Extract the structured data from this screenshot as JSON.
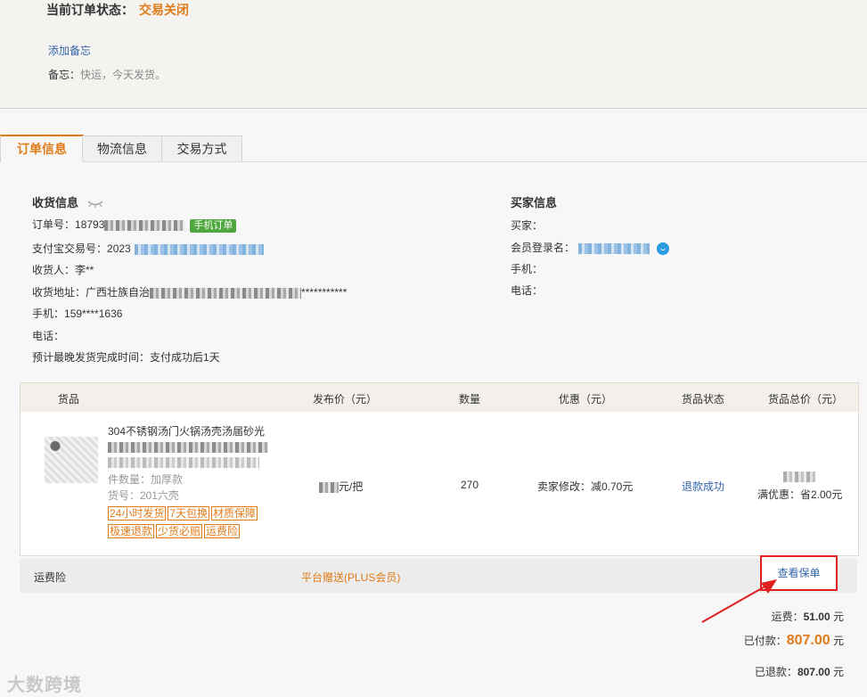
{
  "status": {
    "label": "当前订单状态：",
    "value": "交易关闭"
  },
  "remark": {
    "add_label": "添加备忘",
    "label": "备忘：",
    "value": "快运，今天发货。"
  },
  "tabs": [
    {
      "label": "订单信息"
    },
    {
      "label": "物流信息"
    },
    {
      "label": "交易方式"
    }
  ],
  "receiver": {
    "title": "收货信息",
    "order_no_label": "订单号：",
    "order_no_prefix": "18793",
    "mobile_order_tag": "手机订单",
    "alipay_label": "支付宝交易号：",
    "alipay_prefix": "2023",
    "name_label": "收货人：",
    "name": "李**",
    "address_label": "收货地址：",
    "address_prefix": "广西壮族自治",
    "address_suffix": "***********",
    "phone_label": "手机：",
    "phone": "159****1636",
    "tel_label": "电话：",
    "ship_time_label": "预计最晚发货完成时间：",
    "ship_time": "支付成功后1天"
  },
  "buyer": {
    "title": "买家信息",
    "buyer_label": "买家：",
    "member_label": "会员登录名：",
    "phone_label": "手机：",
    "tel_label": "电话："
  },
  "goods": {
    "headers": {
      "item": "货品",
      "price": "发布价（元）",
      "qty": "数量",
      "discount": "优惠（元）",
      "status": "货品状态",
      "total": "货品总价（元）"
    },
    "product": {
      "name_line1": "304不锈钢汤门火锅汤壳汤届砂光",
      "count_label": "件数量：加厚款",
      "sku_label": "货号：201六壳",
      "badges": [
        "24小时发货",
        "7天包换",
        "材质保障",
        "极速退款",
        "少货必赔",
        "运费险"
      ],
      "price_suffix": "元/把",
      "qty": "270",
      "discount": "卖家修改：减0.70元",
      "status": "退款成功",
      "full_discount": "满优惠：省2.00元"
    }
  },
  "insurance": {
    "label": "运费险",
    "gift": "平台赠送(PLUS会员)",
    "view_button": "查看保单"
  },
  "totals": {
    "shipping_label": "运费：",
    "shipping": "51.00",
    "unit": "元",
    "paid_label": "已付款：",
    "paid": "807.00",
    "refund_label": "已退款：",
    "refund": "807.00"
  },
  "watermark": "大数跨境",
  "colors": {
    "accent": "#e07b1a",
    "link": "#3366aa",
    "highlight": "#e02020"
  }
}
